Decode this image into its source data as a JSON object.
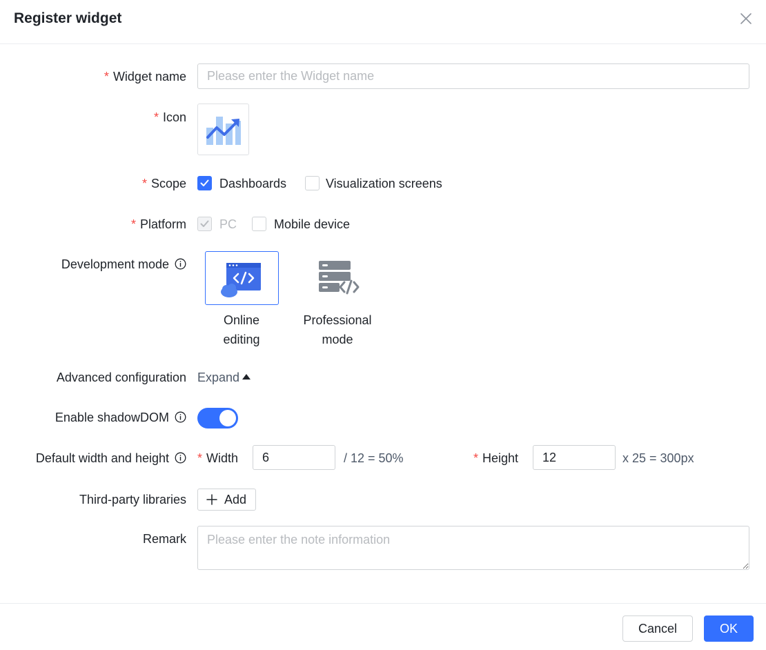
{
  "dialog": {
    "title": "Register widget"
  },
  "form": {
    "widget_name": {
      "required": "*",
      "label": "Widget name",
      "placeholder": "Please enter the Widget name",
      "value": ""
    },
    "icon": {
      "required": "*",
      "label": "Icon",
      "icon_name": "trend-chart-icon"
    },
    "scope": {
      "required": "*",
      "label": "Scope",
      "options": [
        {
          "label": "Dashboards",
          "checked": true
        },
        {
          "label": "Visualization screens",
          "checked": false
        }
      ]
    },
    "platform": {
      "required": "*",
      "label": "Platform",
      "options": [
        {
          "label": "PC",
          "checked": true,
          "disabled": true
        },
        {
          "label": "Mobile device",
          "checked": false
        }
      ]
    },
    "development_mode": {
      "label": "Development mode",
      "options": [
        {
          "line1": "Online",
          "line2": "editing",
          "selected": true,
          "icon": "online-editing-icon"
        },
        {
          "line1": "Professional",
          "line2": "mode",
          "selected": false,
          "icon": "server-code-icon"
        }
      ]
    },
    "advanced_configuration": {
      "label": "Advanced configuration",
      "toggle_text": "Expand"
    },
    "shadow_dom": {
      "label": "Enable shadowDOM",
      "enabled": true
    },
    "default_size": {
      "label": "Default width and height",
      "width_required": "*",
      "width_label": "Width",
      "width_value": "6",
      "width_suffix": "/ 12 = 50%",
      "height_required": "*",
      "height_label": "Height",
      "height_value": "12",
      "height_suffix": "x 25 = 300px"
    },
    "third_party_libraries": {
      "label": "Third-party libraries",
      "add_label": "Add"
    },
    "remark": {
      "label": "Remark",
      "placeholder": "Please enter the note information",
      "value": ""
    }
  },
  "footer": {
    "cancel_label": "Cancel",
    "ok_label": "OK"
  },
  "colors": {
    "primary": "#3370ff",
    "required": "#f54a45",
    "border": "#d0d3d6",
    "placeholder": "#b8bbbf"
  }
}
